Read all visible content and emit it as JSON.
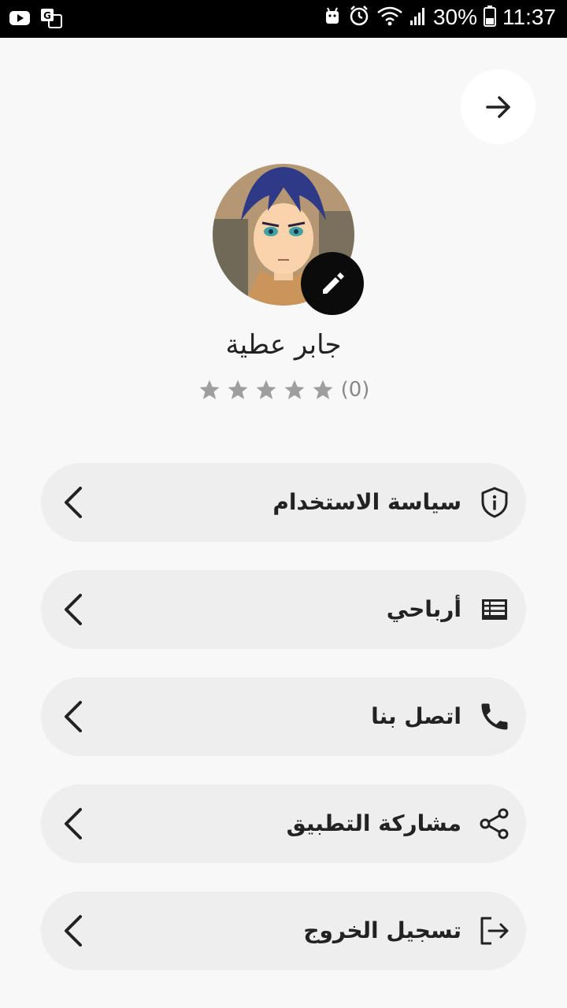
{
  "status_bar": {
    "battery": "30%",
    "time": "11:37"
  },
  "profile": {
    "name": "جابر عطية",
    "rating_count": "(0)",
    "stars": 0
  },
  "menu": [
    {
      "label": "سياسة الاستخدام",
      "icon": "shield-info-icon"
    },
    {
      "label": "أرباحي",
      "icon": "list-icon"
    },
    {
      "label": "اتصل بنا",
      "icon": "phone-icon"
    },
    {
      "label": "مشاركة التطبيق",
      "icon": "share-icon"
    },
    {
      "label": "تسجيل الخروج",
      "icon": "logout-icon"
    }
  ],
  "colors": {
    "background": "#f8f8f8",
    "menu_bg": "#eeeeee",
    "star": "#9e9e9e",
    "edit_button": "#0b0b0b"
  }
}
